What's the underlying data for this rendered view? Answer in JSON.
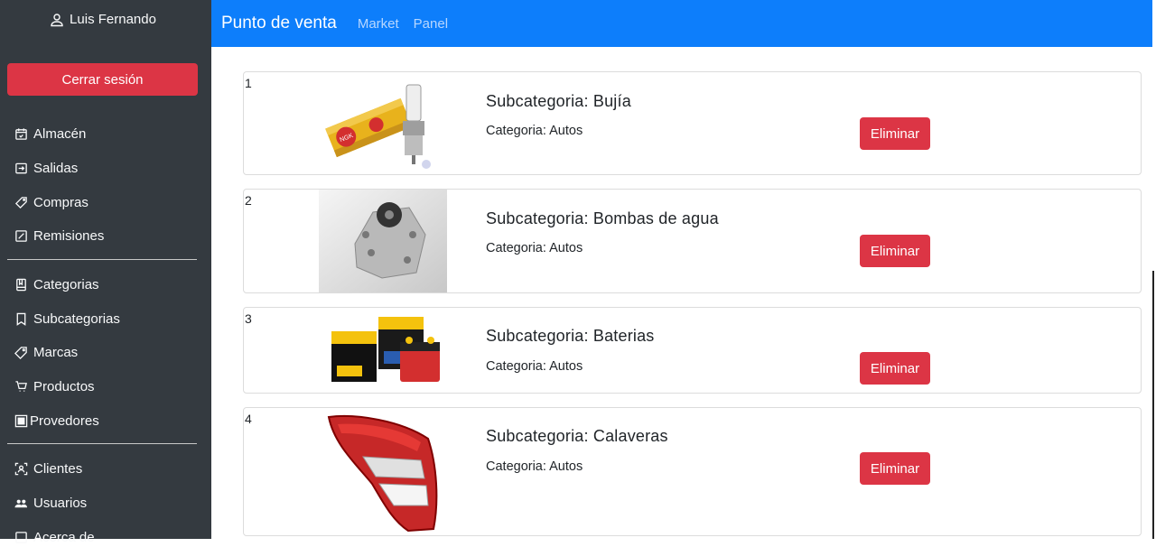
{
  "user": {
    "name": "Luis Fernando"
  },
  "logout_label": "Cerrar sesión",
  "nav": {
    "group1": [
      "Almacén",
      "Salidas",
      "Compras",
      "Remisiones"
    ],
    "group2": [
      "Categorias",
      "Subcategorias",
      "Marcas",
      "Productos",
      "Provedores"
    ],
    "group3": [
      "Clientes",
      "Usuarios",
      "Acerca de"
    ]
  },
  "topbar": {
    "brand": "Punto de venta",
    "links": [
      "Market",
      "Panel"
    ]
  },
  "colors": {
    "sidebar": "#343a40",
    "topbar": "#0d7efb",
    "danger": "#dc3545"
  },
  "cards": [
    {
      "num": "1",
      "title": "Subcategoria: Bujía",
      "category": "Categoria: Autos",
      "delete_label": "Eliminar",
      "image": "spark-plug-image"
    },
    {
      "num": "2",
      "title": "Subcategoria: Bombas de agua",
      "category": "Categoria: Autos",
      "delete_label": "Eliminar",
      "image": "water-pump-image"
    },
    {
      "num": "3",
      "title": "Subcategoria: Baterias",
      "category": "Categoria: Autos",
      "delete_label": "Eliminar",
      "image": "batteries-image"
    },
    {
      "num": "4",
      "title": "Subcategoria: Calaveras",
      "category": "Categoria: Autos",
      "delete_label": "Eliminar",
      "image": "tail-light-image"
    }
  ]
}
